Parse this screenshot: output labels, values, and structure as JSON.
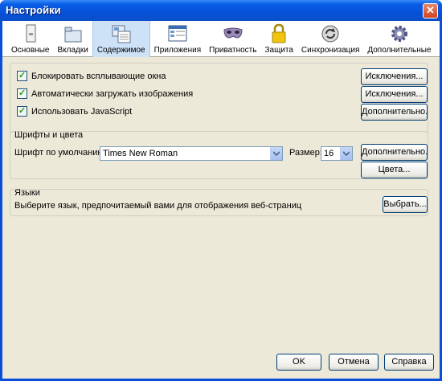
{
  "window": {
    "title": "Настройки"
  },
  "toolbar": {
    "items": [
      {
        "label": "Основные",
        "icon": "general-icon"
      },
      {
        "label": "Вкладки",
        "icon": "tabs-icon"
      },
      {
        "label": "Содержимое",
        "icon": "content-icon",
        "selected": true
      },
      {
        "label": "Приложения",
        "icon": "applications-icon"
      },
      {
        "label": "Приватность",
        "icon": "privacy-mask-icon"
      },
      {
        "label": "Защита",
        "icon": "security-lock-icon"
      },
      {
        "label": "Синхронизация",
        "icon": "sync-icon"
      },
      {
        "label": "Дополнительные",
        "icon": "advanced-gear-icon"
      }
    ]
  },
  "content": {
    "block_popups": {
      "label": "Блокировать всплывающие окна",
      "checked": true,
      "button": "Исключения..."
    },
    "load_images": {
      "label": "Автоматически загружать изображения",
      "checked": true,
      "button": "Исключения..."
    },
    "javascript": {
      "label": "Использовать JavaScript",
      "checked": true,
      "button": "Дополнительно..."
    }
  },
  "fonts": {
    "group_label": "Шрифты и цвета",
    "default_font_label": "Шрифт по умолчанию:",
    "default_font_value": "Times New Roman",
    "size_label": "Размер:",
    "size_value": "16",
    "advanced_button": "Дополнительно...",
    "colors_button": "Цвета..."
  },
  "languages": {
    "group_label": "Языки",
    "description": "Выберите язык, предпочитаемый вами для отображения веб-страниц",
    "choose_button": "Выбрать..."
  },
  "footer": {
    "ok": "OK",
    "cancel": "Отмена",
    "help": "Справка"
  }
}
